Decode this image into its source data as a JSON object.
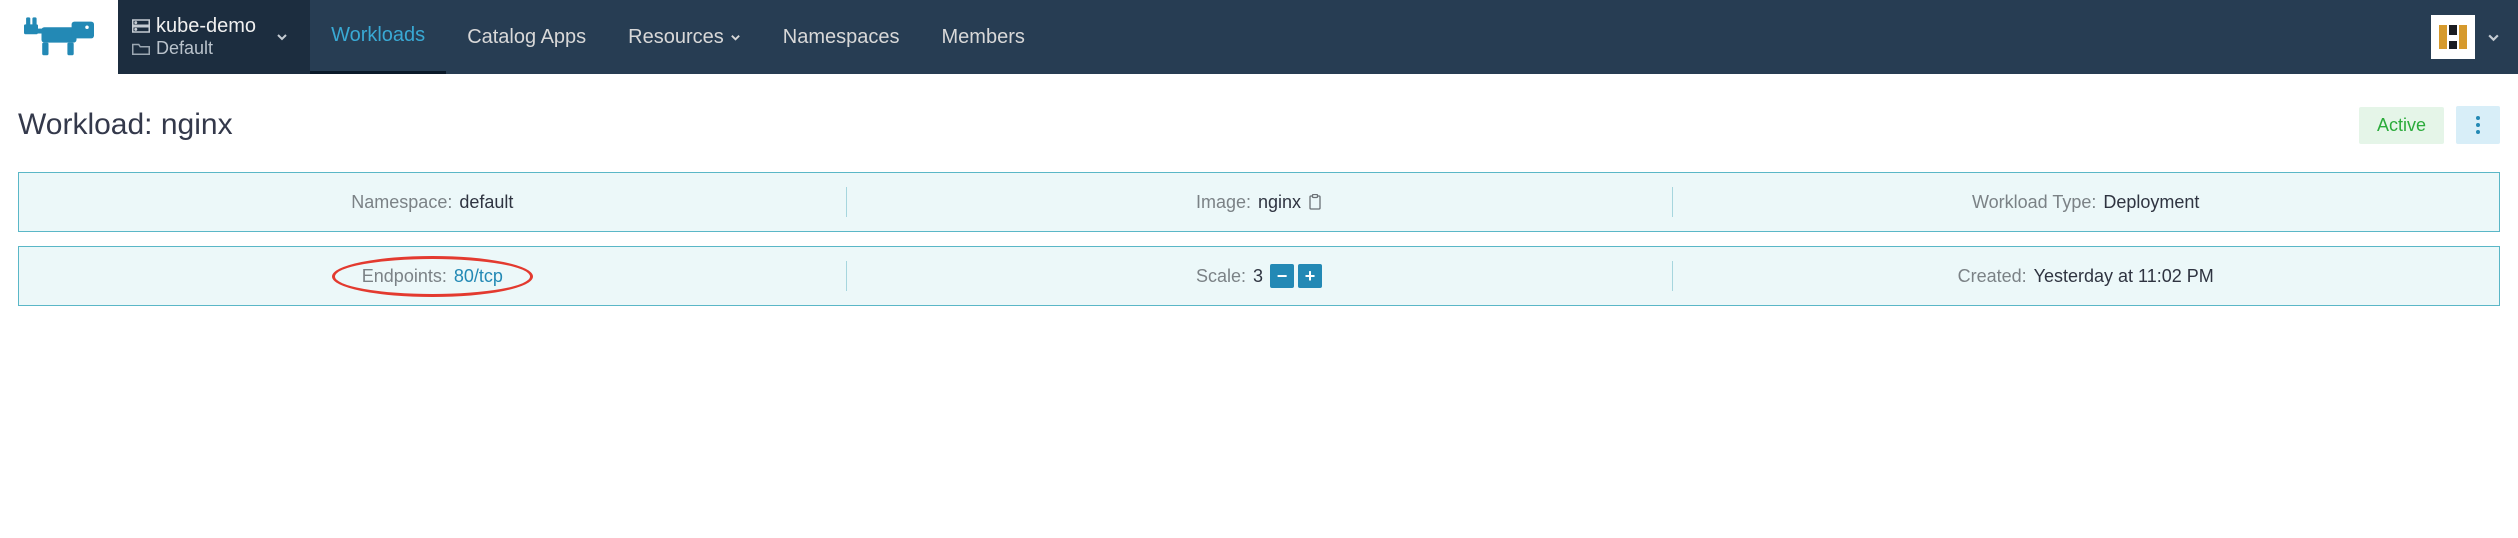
{
  "cluster": {
    "name": "kube-demo",
    "project": "Default"
  },
  "nav": {
    "workloads": "Workloads",
    "catalog_apps": "Catalog Apps",
    "resources": "Resources",
    "namespaces": "Namespaces",
    "members": "Members"
  },
  "page": {
    "title_prefix": "Workload: ",
    "title_name": "nginx",
    "status": "Active"
  },
  "panel1": {
    "namespace_label": "Namespace:",
    "namespace_value": "default",
    "image_label": "Image:",
    "image_value": "nginx",
    "workload_type_label": "Workload Type:",
    "workload_type_value": "Deployment"
  },
  "panel2": {
    "endpoints_label": "Endpoints:",
    "endpoints_value": "80/tcp",
    "scale_label": "Scale:",
    "scale_value": "3",
    "created_label": "Created:",
    "created_value": "Yesterday at 11:02 PM"
  }
}
